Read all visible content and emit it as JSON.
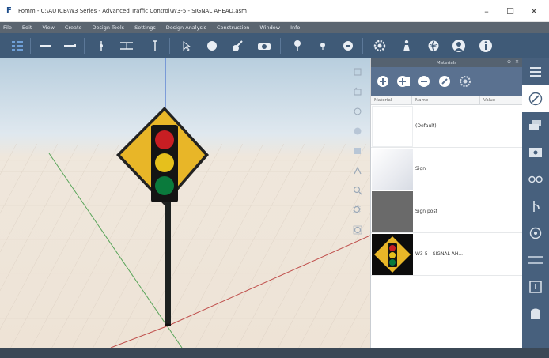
{
  "window": {
    "title": "Fomm - C:\\AUTCB\\W3 Series - Advanced Traffic Control\\W3-5 - SIGNAL AHEAD.asm",
    "controls": [
      "–",
      "☐",
      "✕"
    ]
  },
  "menu": {
    "items": [
      "File",
      "Edit",
      "View",
      "Create",
      "Design Tools",
      "Settings",
      "Design Analysis",
      "Construction",
      "Window",
      "Info"
    ]
  },
  "toolbar": {
    "icons": [
      "tree-view-icon",
      "line-icon",
      "arrow-line-icon",
      "point-icon",
      "dimension-icon",
      "text-cursor-icon",
      "select-icon",
      "circle-icon",
      "paint-icon",
      "camera-icon",
      "pin-icon",
      "small-pin-icon",
      "minus-circle-icon",
      "gear-icon",
      "figure-icon",
      "globe-icon",
      "user-icon",
      "info-icon"
    ]
  },
  "materials": {
    "title": "Materials",
    "pin_label": "⊕",
    "close_label": "✕",
    "tools": [
      "add-icon",
      "add-library-icon",
      "remove-icon",
      "edit-icon",
      "settings-icon"
    ],
    "columns": [
      "Material",
      "Name",
      "Value"
    ],
    "rows": [
      {
        "name": "(Default)",
        "thumb": "white"
      },
      {
        "name": "Sign",
        "thumb": "light"
      },
      {
        "name": "Sign post",
        "thumb": "dark"
      },
      {
        "name": "W3-5 - SIGNAL AH...",
        "thumb": "sign"
      }
    ]
  },
  "sidebar": {
    "icons": [
      "list-icon",
      "pencil-icon",
      "layers-icon",
      "image-icon",
      "glasses-icon",
      "branch-icon",
      "target-icon",
      "rack-icon",
      "export-icon",
      "import-icon"
    ],
    "active_index": 1
  },
  "colors": {
    "accent": "#3f5a77",
    "sign_yellow": "#e8b628",
    "sign_red": "#c81e23",
    "sign_amber": "#e6c01c",
    "sign_green": "#0a7a3c",
    "x_axis": "#c0504d",
    "y_axis": "#5aa55a",
    "z_axis": "#4a74d0"
  }
}
